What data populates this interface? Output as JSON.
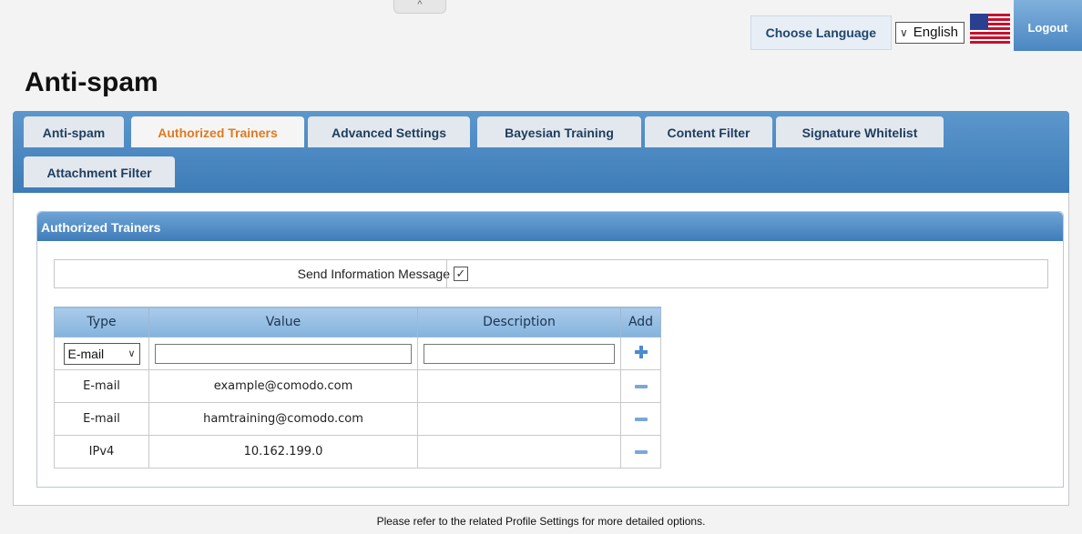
{
  "header": {
    "collapse_glyph": "^",
    "choose_language_label": "Choose Language",
    "language_selected": "English",
    "logout_label": "Logout"
  },
  "page_title": "Anti-spam",
  "tabs": [
    {
      "label": "Anti-spam",
      "active": false
    },
    {
      "label": "Authorized Trainers",
      "active": true
    },
    {
      "label": "Advanced Settings",
      "active": false
    },
    {
      "label": "Bayesian Training",
      "active": false
    },
    {
      "label": "Content Filter",
      "active": false
    },
    {
      "label": "Signature Whitelist",
      "active": false
    },
    {
      "label": "Attachment Filter",
      "active": false
    }
  ],
  "section": {
    "title": "Authorized Trainers",
    "send_info_label": "Send Information Message",
    "send_info_checked": true
  },
  "table": {
    "headers": [
      "Type",
      "Value",
      "Description",
      "Add"
    ],
    "new_row": {
      "type_selected": "E-mail",
      "value": "",
      "description": ""
    },
    "rows": [
      {
        "type": "E-mail",
        "value": "example@comodo.com",
        "description": ""
      },
      {
        "type": "E-mail",
        "value": "hamtraining@comodo.com",
        "description": ""
      },
      {
        "type": "IPv4",
        "value": "10.162.199.0",
        "description": ""
      }
    ]
  },
  "footer_note": "Please refer to the related Profile Settings for more detailed options.",
  "colors": {
    "accent_blue": "#3f7cb9",
    "active_tab_text": "#e07a1f",
    "header_text": "#20476e"
  }
}
